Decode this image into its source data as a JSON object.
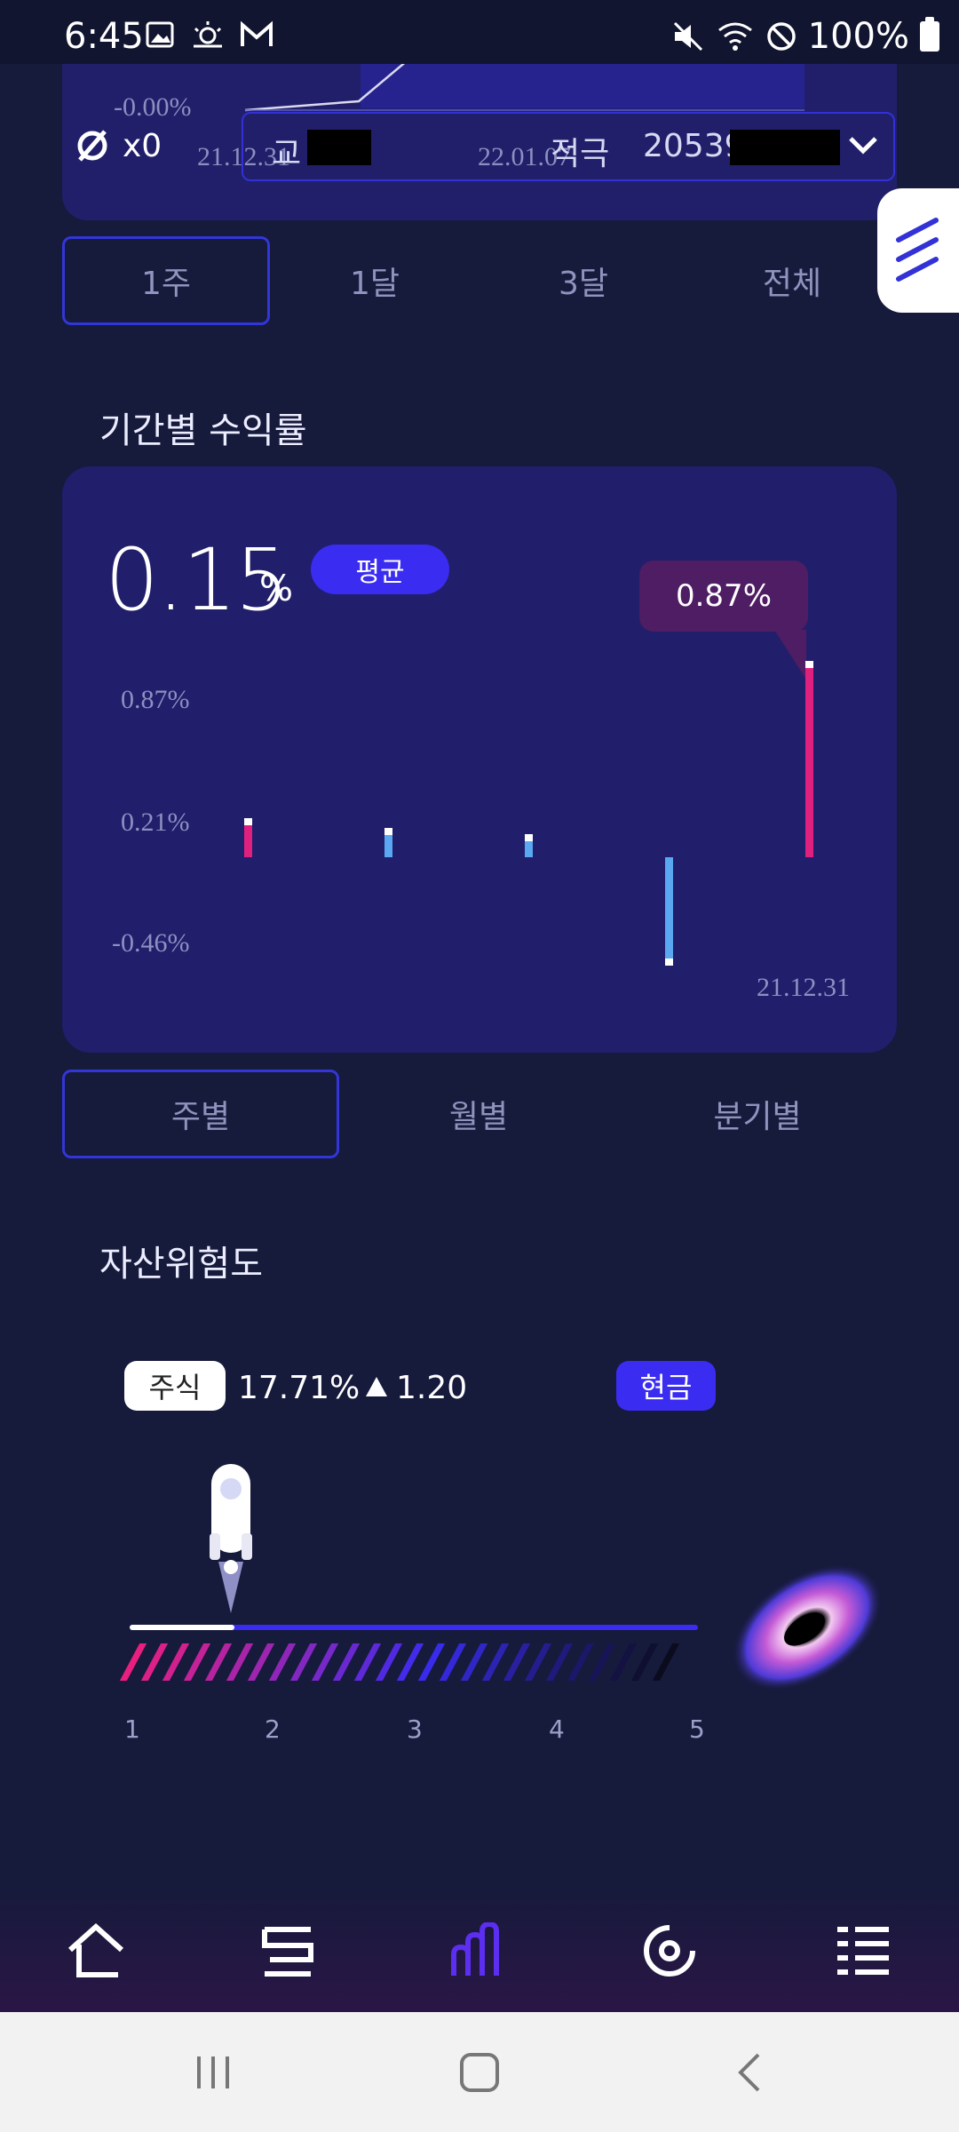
{
  "status_bar": {
    "time": "6:45",
    "battery": "100%"
  },
  "top_card": {
    "y_value": "-0.00%",
    "x_ticks": [
      "21.12.31",
      "22.01.07"
    ],
    "multiplier": "x0",
    "account": {
      "type_prefix": "교",
      "name": "적극",
      "number_prefix": "20539"
    }
  },
  "period_tabs": [
    {
      "label": "1주",
      "active": true
    },
    {
      "label": "1달",
      "active": false
    },
    {
      "label": "3달",
      "active": false
    },
    {
      "label": "전체",
      "active": false
    }
  ],
  "returns_section": {
    "title": "기간별 수익률",
    "average_value": "0.15",
    "average_unit": "%",
    "average_badge": "평균",
    "tooltip": "0.87%",
    "y_labels": [
      "0.87%",
      "0.21%",
      "-0.46%"
    ],
    "x_label": "21.12.31"
  },
  "chart_data": {
    "type": "bar",
    "y_ticks": [
      0.87,
      0.21,
      -0.46
    ],
    "ylim": [
      -0.46,
      0.87
    ],
    "x_tick": "21.12.31",
    "values": [
      0.2,
      0.14,
      0.1,
      -0.64,
      1.2
    ],
    "bar_colors": [
      "#e0207f",
      "#5aa7f2",
      "#5aa7f2",
      "#5aa7f2",
      "#e0207f"
    ]
  },
  "granularity_tabs": [
    {
      "label": "주별",
      "active": true
    },
    {
      "label": "월별",
      "active": false
    },
    {
      "label": "분기별",
      "active": false
    }
  ],
  "risk_section": {
    "title": "자산위험도",
    "stock_label": "주식",
    "stock_percent": "17.71%",
    "stock_change": "1.20",
    "cash_label": "현금",
    "scale": [
      "1",
      "2",
      "3",
      "4",
      "5"
    ],
    "level": 1.73
  },
  "colors": {
    "accent": "#3a2cf0",
    "positive": "#e0207f",
    "negative": "#5aa7f2",
    "background": "#161a3b",
    "card": "#211e6b"
  },
  "bottom_nav": [
    {
      "icon": "home-icon"
    },
    {
      "icon": "list-icon"
    },
    {
      "icon": "chart-icon",
      "active": true
    },
    {
      "icon": "target-icon"
    },
    {
      "icon": "menu-icon"
    }
  ]
}
